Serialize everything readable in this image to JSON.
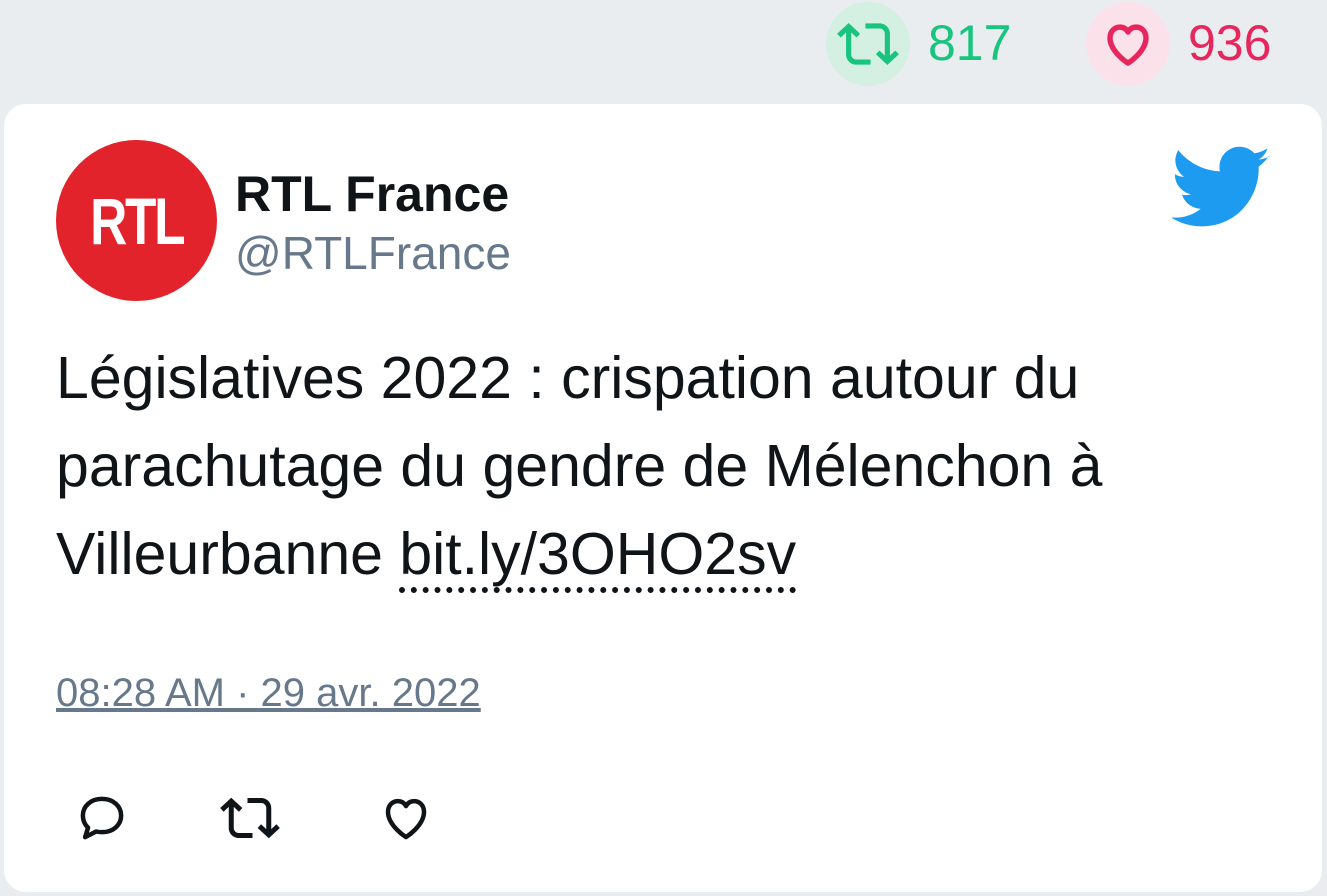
{
  "stats": {
    "retweet_count": "817",
    "like_count": "936"
  },
  "author": {
    "avatar_text": "RTL",
    "name": "RTL France",
    "handle": "@RTLFrance"
  },
  "tweet": {
    "text": "Législatives 2022 : crispation autour du parachutage du gendre de Mélenchon à Villeurbanne ",
    "link": "bit.ly/3OHO2sv",
    "timestamp": "08:28 AM · 29 avr. 2022"
  },
  "icons": {
    "retweet": "retweet-icon",
    "like": "heart-icon",
    "reply": "reply-icon",
    "brand": "twitter-bird-icon"
  },
  "colors": {
    "retweet": "#19c47e",
    "like": "#e8265e",
    "brand": "#1d9bf0",
    "avatar_bg": "#e3232b"
  }
}
